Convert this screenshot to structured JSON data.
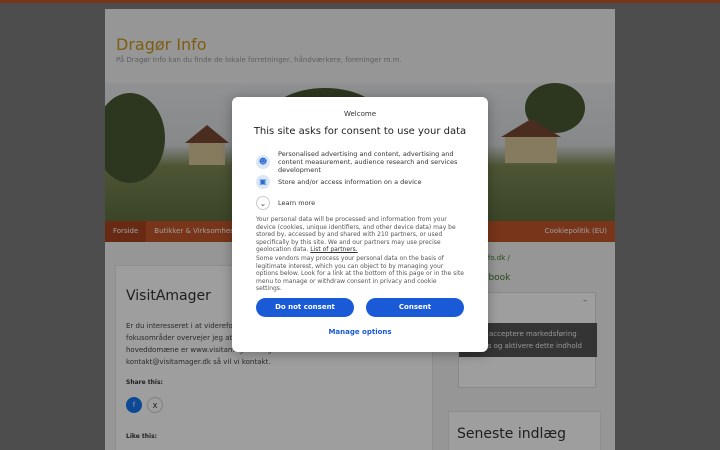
{
  "site": {
    "title": "Dragør Info",
    "tagline": "På Dragør Info kan du finde de lokale forretninger, håndværkere, foreninger m.m."
  },
  "nav": {
    "items": [
      "Forside",
      "Butikker & Virksomheder",
      "Cookiepolitik (EU)"
    ]
  },
  "post": {
    "title": "VisitAmager",
    "text": "Er du interesseret i at videreformidle noget om Amager, eller har du et af vores fokusområder overvejer jeg at oprette en side. Hvis du vil skrive om dit emne, er hoveddomæne er www.visitamager.dk og du er velkommen til at sende en mail til kontakt@visitamager.dk så vil vi kontakt.",
    "share_label": "Share this:",
    "like_label": "Like this:",
    "share_fb_icon": "f",
    "share_x_icon": "X"
  },
  "sidebar": {
    "breadcrumb": "dragoerinfo.dk /",
    "facebook_title": "på Facebook",
    "facebook_dash": "–",
    "blocked_text": "Klik at acceptere markedsføring cookies og aktivere dette indhold",
    "recent_title": "Seneste indlæg"
  },
  "consent": {
    "welcome": "Welcome",
    "title": "This site asks for consent to use your data",
    "purposes": [
      {
        "icon": "person-icon",
        "glyph": "☻",
        "text": "Personalised advertising and content, advertising and content measurement, audience research and services development"
      },
      {
        "icon": "device-icon",
        "glyph": "▣",
        "text": "Store and/or access information on a device"
      },
      {
        "icon": "chevron-down-icon",
        "glyph": "⌄",
        "text": "Learn more"
      }
    ],
    "body1": "Your personal data will be processed and information from your device (cookies, unique identifiers, and other device data) may be stored by, accessed by and shared with 210 partners, or used specifically by this site. We and our partners may use precise geolocation data.",
    "partners_link": "List of partners.",
    "body2": "Some vendors may process your personal data on the basis of legitimate interest, which you can object to by managing your options below. Look for a link at the bottom of this page or in the site menu to manage or withdraw consent in privacy and cookie settings.",
    "do_not_consent": "Do not consent",
    "consent": "Consent",
    "manage": "Manage options"
  },
  "colors": {
    "accent": "#c2562b",
    "consent_blue": "#1a5ad7"
  }
}
